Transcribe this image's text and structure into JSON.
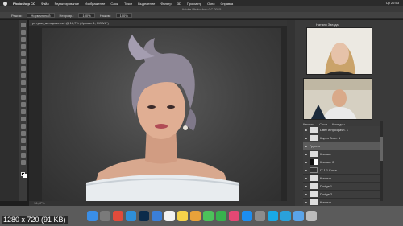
{
  "menubar": {
    "app_name": "Photoshop CC",
    "items": [
      "Файл",
      "Редактирование",
      "Изображение",
      "Слои",
      "Текст",
      "Выделение",
      "Фильтр",
      "3D",
      "Просмотр",
      "Окно",
      "Справка"
    ],
    "clock": "Ср 22:53"
  },
  "window": {
    "title": "Adobe Photoshop CC 2015"
  },
  "options_bar": {
    "mode_label": "Режим:",
    "mode_value": "Нормальный",
    "opacity_label": "Непрозр.:",
    "opacity_value": "100%",
    "flow_label": "Нажим:",
    "flow_value": "100%"
  },
  "document": {
    "tab_label": "ретушь_женщина.psd @ 16,7% (Кривые 1, RGB/8*)"
  },
  "status": {
    "zoom": "16,67%"
  },
  "video_panel": {
    "title": "Натали Звезда"
  },
  "layers_panel": {
    "header": [
      "Каналы",
      "Слои",
      "Контуры"
    ],
    "rows": [
      {
        "name": "Цвет и прозрачн. 1",
        "thumb": "light",
        "selected": false
      },
      {
        "name": "Карта Текст 1",
        "thumb": "light",
        "selected": false
      },
      {
        "name": "Группа",
        "thumb": "none",
        "selected": true
      },
      {
        "name": "Кривые",
        "thumb": "light",
        "selected": false
      },
      {
        "name": "Кривые 0",
        "thumb": "mask",
        "selected": false
      },
      {
        "name": "IT 1,1 Кожа",
        "thumb": "dark",
        "selected": false
      },
      {
        "name": "Кривые",
        "thumb": "light",
        "selected": false
      },
      {
        "name": "Dodge 1",
        "thumb": "light",
        "selected": false
      },
      {
        "name": "Dodge 2",
        "thumb": "light",
        "selected": false
      },
      {
        "name": "Кривые",
        "thumb": "light",
        "selected": false
      }
    ]
  },
  "overlay": {
    "label": "1280 x 720 (91 KB)"
  },
  "dock": {
    "icons": [
      {
        "name": "finder-icon",
        "color": "#3a8ee6"
      },
      {
        "name": "launchpad-icon",
        "color": "#7a7a7a"
      },
      {
        "name": "chrome-icon",
        "color": "#e14b3b"
      },
      {
        "name": "safari-icon",
        "color": "#2f8fd8"
      },
      {
        "name": "photoshop-icon",
        "color": "#0b2b4a"
      },
      {
        "name": "mail-icon",
        "color": "#3b7fd8"
      },
      {
        "name": "calendar-icon",
        "color": "#f2f2f2"
      },
      {
        "name": "notes-icon",
        "color": "#f5d24a"
      },
      {
        "name": "photos-icon",
        "color": "#e8a23a"
      },
      {
        "name": "messages-icon",
        "color": "#4cc25a"
      },
      {
        "name": "facetime-icon",
        "color": "#37b24d"
      },
      {
        "name": "itunes-icon",
        "color": "#e54874"
      },
      {
        "name": "appstore-icon",
        "color": "#1d8ef0"
      },
      {
        "name": "preferences-icon",
        "color": "#8c8c8c"
      },
      {
        "name": "skype-icon",
        "color": "#19a9e5"
      },
      {
        "name": "telegram-icon",
        "color": "#2aa1da"
      },
      {
        "name": "folder-icon",
        "color": "#5aa4e8"
      },
      {
        "name": "trash-icon",
        "color": "#bcbcbc"
      }
    ]
  }
}
